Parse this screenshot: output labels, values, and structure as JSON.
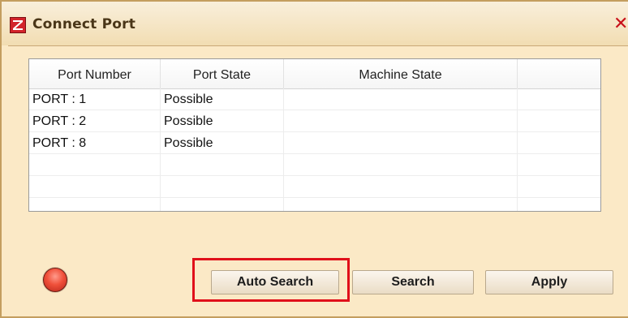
{
  "window": {
    "title": "Connect Port",
    "close_label": "✕"
  },
  "table": {
    "columns": [
      "Port Number",
      "Port State",
      "Machine State",
      ""
    ],
    "rows": [
      {
        "port_number": "PORT : 1",
        "port_state": "Possible",
        "machine_state": ""
      },
      {
        "port_number": "PORT : 2",
        "port_state": "Possible",
        "machine_state": ""
      },
      {
        "port_number": "PORT : 8",
        "port_state": "Possible",
        "machine_state": ""
      },
      {
        "port_number": "",
        "port_state": "",
        "machine_state": ""
      },
      {
        "port_number": "",
        "port_state": "",
        "machine_state": ""
      },
      {
        "port_number": "",
        "port_state": "",
        "machine_state": ""
      }
    ]
  },
  "buttons": {
    "auto_search": "Auto Search",
    "search": "Search",
    "apply": "Apply"
  },
  "status": {
    "led_color": "#f0503a",
    "led_icon": "status-led-icon"
  },
  "colors": {
    "window_bg": "#fbe9c6",
    "highlight": "#e0101a",
    "close": "#c8101a"
  }
}
